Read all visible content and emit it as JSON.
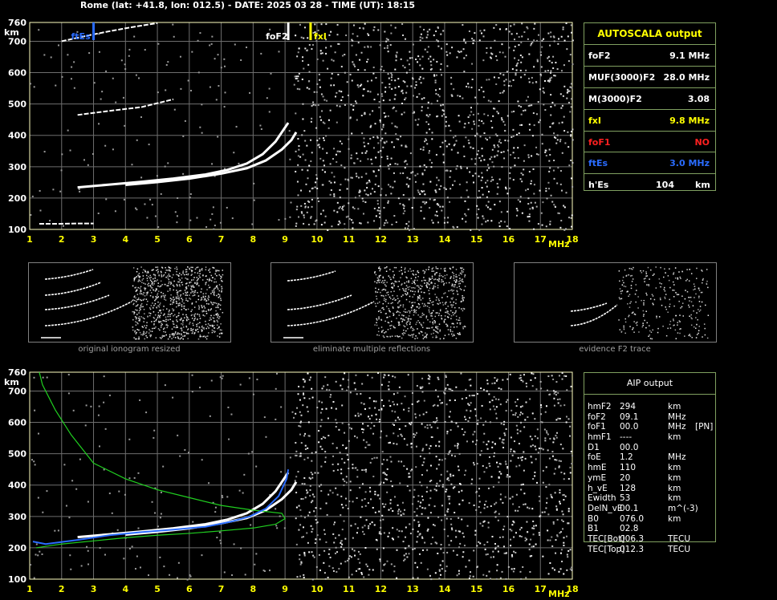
{
  "header": "Rome (lat: +41.8, lon: 012.5) - DATE: 2025 03 28 - TIME (UT): 18:15",
  "colors": {
    "grid": "#6e6e6e",
    "frame": "#ffffc0",
    "panel_border": "#80a060",
    "yellow": "#ffff00",
    "red": "#ff2020",
    "blue": "#2a6cff",
    "green": "#20d020",
    "white": "#ffffff"
  },
  "autoscala": {
    "title": "AUTOSCALA output",
    "rows": [
      {
        "label": "foF2",
        "value": "9.1 MHz",
        "color": "#ffffff"
      },
      {
        "label": "MUF(3000)F2",
        "value": "28.0 MHz",
        "color": "#ffffff"
      },
      {
        "label": "M(3000)F2",
        "value": "3.08",
        "color": "#ffffff"
      },
      {
        "label": "fxI",
        "value": "9.8 MHz",
        "color": "#ffff00"
      },
      {
        "label": "foF1",
        "value": "NO",
        "color": "#ff2020"
      },
      {
        "label": "ftEs",
        "value": "3.0 MHz",
        "color": "#2a6cff"
      },
      {
        "label": "h'Es",
        "value": "104",
        "unit": "km",
        "color": "#ffffff"
      }
    ]
  },
  "aip": {
    "title": "AIP output",
    "rows": [
      {
        "label": "hmF2",
        "value": "294",
        "unit": "km",
        "extra": ""
      },
      {
        "label": "foF2",
        "value": "09.1",
        "unit": "MHz",
        "extra": ""
      },
      {
        "label": "foF1",
        "value": "00.0",
        "unit": "MHz",
        "extra": "[PN]"
      },
      {
        "label": "hmF1",
        "value": "----",
        "unit": "km",
        "extra": ""
      },
      {
        "label": "D1",
        "value": "00.0",
        "unit": "",
        "extra": ""
      },
      {
        "label": "foE",
        "value": "1.2",
        "unit": "MHz",
        "extra": ""
      },
      {
        "label": "hmE",
        "value": "110",
        "unit": "km",
        "extra": ""
      },
      {
        "label": "ymE",
        "value": "20",
        "unit": "km",
        "extra": ""
      },
      {
        "label": "h_vE",
        "value": "128",
        "unit": "km",
        "extra": ""
      },
      {
        "label": "Ewidth",
        "value": "53",
        "unit": "km",
        "extra": ""
      },
      {
        "label": "DelN_vE",
        "value": "00.1",
        "unit": "m^(-3)",
        "extra": ""
      },
      {
        "label": "B0",
        "value": "076.0",
        "unit": "km",
        "extra": ""
      },
      {
        "label": "B1",
        "value": "02.8",
        "unit": "",
        "extra": ""
      },
      {
        "label": "TEC[Bot]",
        "value": "006.3",
        "unit": "TECU",
        "extra": ""
      },
      {
        "label": "TEC[Top]",
        "value": "012.3",
        "unit": "TECU",
        "extra": ""
      }
    ]
  },
  "captions": [
    "original ionogram resized",
    "eliminate multiple reflections",
    "evidence F2 trace"
  ],
  "chart_data": [
    {
      "type": "scatter",
      "name": "top-ionogram",
      "xlabel": "MHz",
      "ylabel": "km",
      "xlim": [
        1,
        18
      ],
      "ylim": [
        100,
        760
      ],
      "x_ticks": [
        1,
        2,
        3,
        4,
        5,
        6,
        7,
        8,
        9,
        10,
        11,
        12,
        13,
        14,
        15,
        16,
        17,
        18
      ],
      "y_ticks": [
        100,
        200,
        300,
        400,
        500,
        600,
        700,
        760
      ],
      "markers": [
        {
          "label": "ftEs",
          "x": 3.0,
          "color": "#2a6cff"
        },
        {
          "label": "foF2",
          "x": 9.1,
          "color": "#ffffff"
        },
        {
          "label": "fxI",
          "x": 9.8,
          "color": "#ffff00"
        }
      ],
      "traces": [
        {
          "name": "Es",
          "points": [
            [
              1.3,
              118
            ],
            [
              2,
              118
            ],
            [
              2.5,
              119
            ],
            [
              3.0,
              119
            ]
          ]
        },
        {
          "name": "F2 o-mode",
          "points": [
            [
              2.5,
              234
            ],
            [
              3.5,
              243
            ],
            [
              4.5,
              252
            ],
            [
              5.5,
              262
            ],
            [
              6.5,
              275
            ],
            [
              7.2,
              290
            ],
            [
              7.8,
              310
            ],
            [
              8.3,
              340
            ],
            [
              8.7,
              380
            ],
            [
              8.9,
              410
            ],
            [
              9.1,
              440
            ]
          ]
        },
        {
          "name": "F2 x-mode",
          "points": [
            [
              4.0,
              242
            ],
            [
              5.0,
              251
            ],
            [
              6.0,
              262
            ],
            [
              7.0,
              278
            ],
            [
              7.8,
              295
            ],
            [
              8.4,
              320
            ],
            [
              8.9,
              355
            ],
            [
              9.2,
              385
            ],
            [
              9.35,
              410
            ]
          ]
        },
        {
          "name": "2F2",
          "points": [
            [
              2.5,
              465
            ],
            [
              3.5,
              478
            ],
            [
              4.5,
              490
            ],
            [
              5.5,
              515
            ]
          ]
        },
        {
          "name": "3F2",
          "points": [
            [
              2.0,
              700
            ],
            [
              2.8,
              718
            ],
            [
              3.5,
              732
            ],
            [
              4.2,
              745
            ],
            [
              5.0,
              758
            ]
          ]
        }
      ]
    },
    {
      "type": "scatter",
      "name": "bottom-ionogram",
      "xlabel": "MHz",
      "ylabel": "km",
      "xlim": [
        1,
        18
      ],
      "ylim": [
        100,
        760
      ],
      "x_ticks": [
        1,
        2,
        3,
        4,
        5,
        6,
        7,
        8,
        9,
        10,
        11,
        12,
        13,
        14,
        15,
        16,
        17,
        18
      ],
      "y_ticks": [
        100,
        200,
        300,
        400,
        500,
        600,
        700,
        760
      ],
      "traces": [
        {
          "name": "F2 o-mode",
          "points": [
            [
              2.5,
              234
            ],
            [
              3.5,
              243
            ],
            [
              4.5,
              252
            ],
            [
              5.5,
              262
            ],
            [
              6.5,
              275
            ],
            [
              7.2,
              290
            ],
            [
              7.8,
              310
            ],
            [
              8.3,
              340
            ],
            [
              8.7,
              380
            ],
            [
              8.9,
              410
            ],
            [
              9.1,
              440
            ]
          ]
        },
        {
          "name": "F2 x-mode",
          "points": [
            [
              4.0,
              242
            ],
            [
              5.0,
              251
            ],
            [
              6.0,
              262
            ],
            [
              7.0,
              278
            ],
            [
              7.8,
              295
            ],
            [
              8.4,
              320
            ],
            [
              8.9,
              355
            ],
            [
              9.2,
              385
            ],
            [
              9.35,
              410
            ]
          ]
        }
      ],
      "blue_fit": [
        [
          1.1,
          220
        ],
        [
          1.5,
          212
        ],
        [
          2.5,
          225
        ],
        [
          3.5,
          240
        ],
        [
          4.5,
          250
        ],
        [
          5.5,
          258
        ],
        [
          6.5,
          267
        ],
        [
          7.3,
          283
        ],
        [
          7.9,
          300
        ],
        [
          8.4,
          325
        ],
        [
          8.8,
          365
        ],
        [
          9.05,
          420
        ],
        [
          9.1,
          450
        ]
      ],
      "green_profile": [
        [
          1.2,
          200
        ],
        [
          2,
          212
        ],
        [
          3,
          222
        ],
        [
          4,
          232
        ],
        [
          5,
          240
        ],
        [
          6,
          246
        ],
        [
          7,
          254
        ],
        [
          8,
          263
        ],
        [
          8.7,
          275
        ],
        [
          9.0,
          293
        ],
        [
          8.9,
          310
        ],
        [
          8.0,
          320
        ],
        [
          7,
          335
        ],
        [
          6,
          360
        ],
        [
          5,
          385
        ],
        [
          4,
          420
        ],
        [
          3,
          470
        ],
        [
          2.3,
          560
        ],
        [
          1.8,
          640
        ],
        [
          1.4,
          720
        ],
        [
          1.3,
          760
        ]
      ]
    }
  ]
}
